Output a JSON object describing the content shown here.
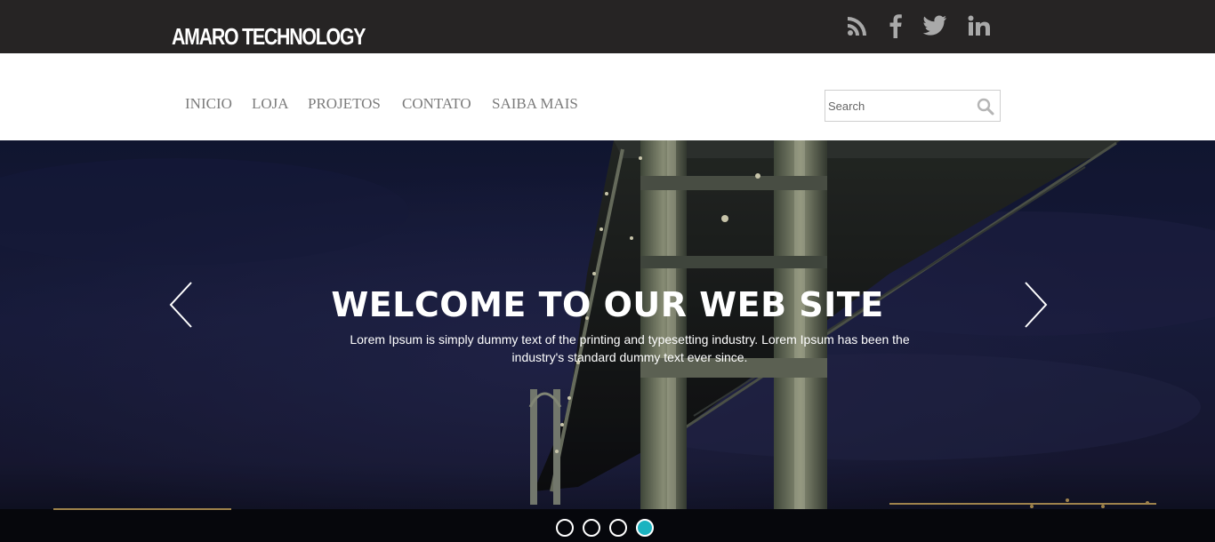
{
  "header": {
    "logo": "AMARO TECHNOLOGY",
    "social": [
      "rss-icon",
      "facebook-icon",
      "twitter-icon",
      "linkedin-icon"
    ]
  },
  "nav": {
    "items": [
      "INICIO",
      "LOJA",
      "PROJETOS",
      "CONTATO",
      "SAIBA MAIS"
    ]
  },
  "search": {
    "placeholder": "Search",
    "icon": "search-icon"
  },
  "hero": {
    "title": "WELCOME TO OUR WEB SITE",
    "text": "Lorem Ipsum is simply dummy text of the printing and typesetting industry. Lorem Ipsum has been the industry's standard dummy text ever since.",
    "slide_count": 4,
    "active_slide": 4,
    "accent_color": "#1cb3c0"
  },
  "colors": {
    "topbar": "#262424",
    "nav_text": "#7b7b7b"
  }
}
